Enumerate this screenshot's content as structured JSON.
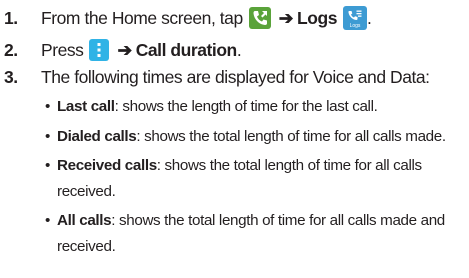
{
  "steps": [
    {
      "num": "1.",
      "text_before": "From the Home screen, tap",
      "icon1": "phone-icon",
      "arrow": "➔",
      "bold_label": "Logs",
      "icon2": "logs-icon",
      "icon2_caption": "Logs",
      "text_after": "."
    },
    {
      "num": "2.",
      "text_before": "Press",
      "icon1": "menu-icon",
      "arrow": "➔",
      "bold_label": "Call duration",
      "text_after": "."
    },
    {
      "num": "3.",
      "text": "The following times are displayed for Voice and Data:"
    }
  ],
  "bullets": [
    {
      "bullet": "•",
      "term": "Last call",
      "description": ": shows the length of time for the last call."
    },
    {
      "bullet": "•",
      "term": "Dialed calls",
      "description": ": shows the total length of time for all calls made."
    },
    {
      "bullet": "•",
      "term": "Received calls",
      "description": ": shows the total length of time for all calls received."
    },
    {
      "bullet": "•",
      "term": "All calls",
      "description": ": shows the total length of time for all calls made and received."
    }
  ],
  "colors": {
    "text": "#231f20",
    "phone_icon": "#5aa33a",
    "logs_icon": "#3d9bd3",
    "menu_icon": "#30b3e6"
  }
}
